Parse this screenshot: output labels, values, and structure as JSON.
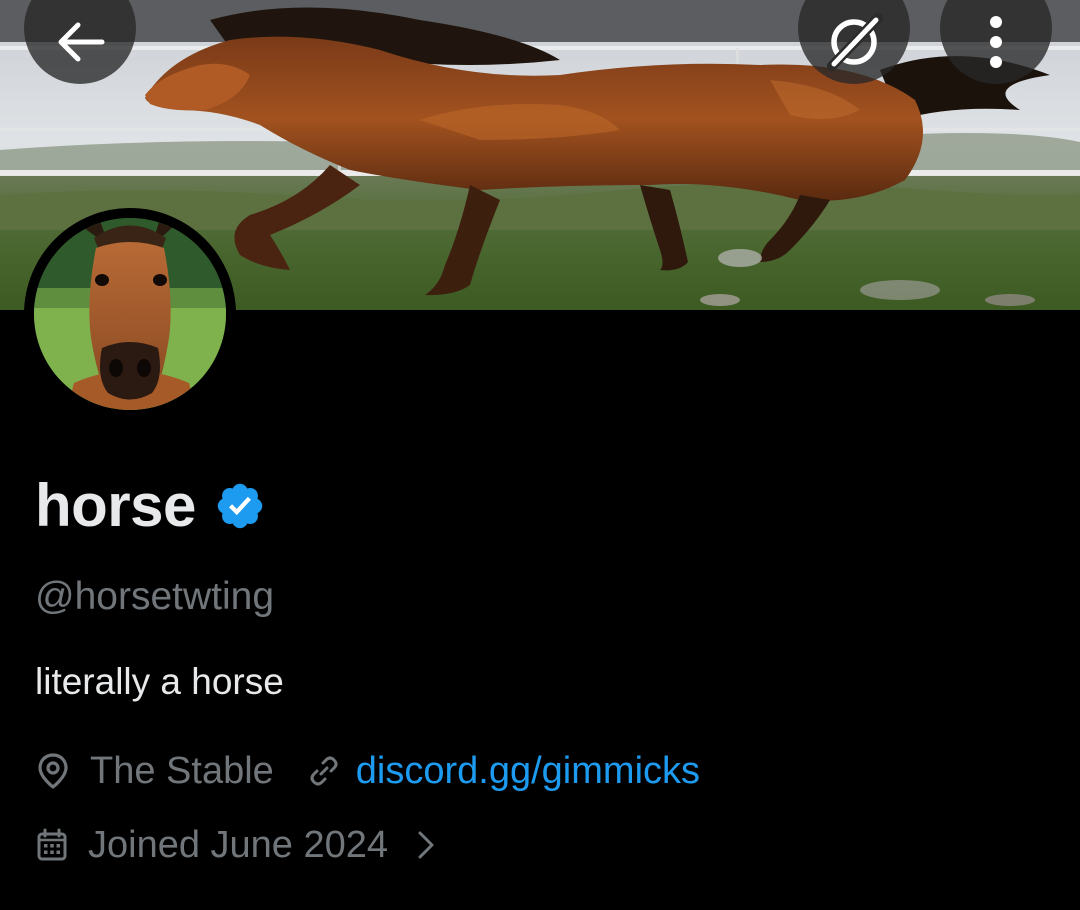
{
  "header": {
    "back_icon": "arrow-left-icon",
    "grok_icon": "grok-icon",
    "more_icon": "more-vertical-icon"
  },
  "profile": {
    "display_name": "horse",
    "verified": true,
    "verified_color": "#1d9bf0",
    "handle": "@horsetwting",
    "bio": "literally a horse",
    "location": "The Stable",
    "location_icon": "location-pin-icon",
    "link": "discord.gg/gimmicks",
    "link_icon": "link-icon",
    "joined": "Joined June 2024",
    "joined_icon": "calendar-icon",
    "joined_chevron_icon": "chevron-right-icon"
  },
  "colors": {
    "background": "#000000",
    "primary_text": "#e7e9ea",
    "secondary_text": "#71767b",
    "accent": "#1d9bf0"
  }
}
